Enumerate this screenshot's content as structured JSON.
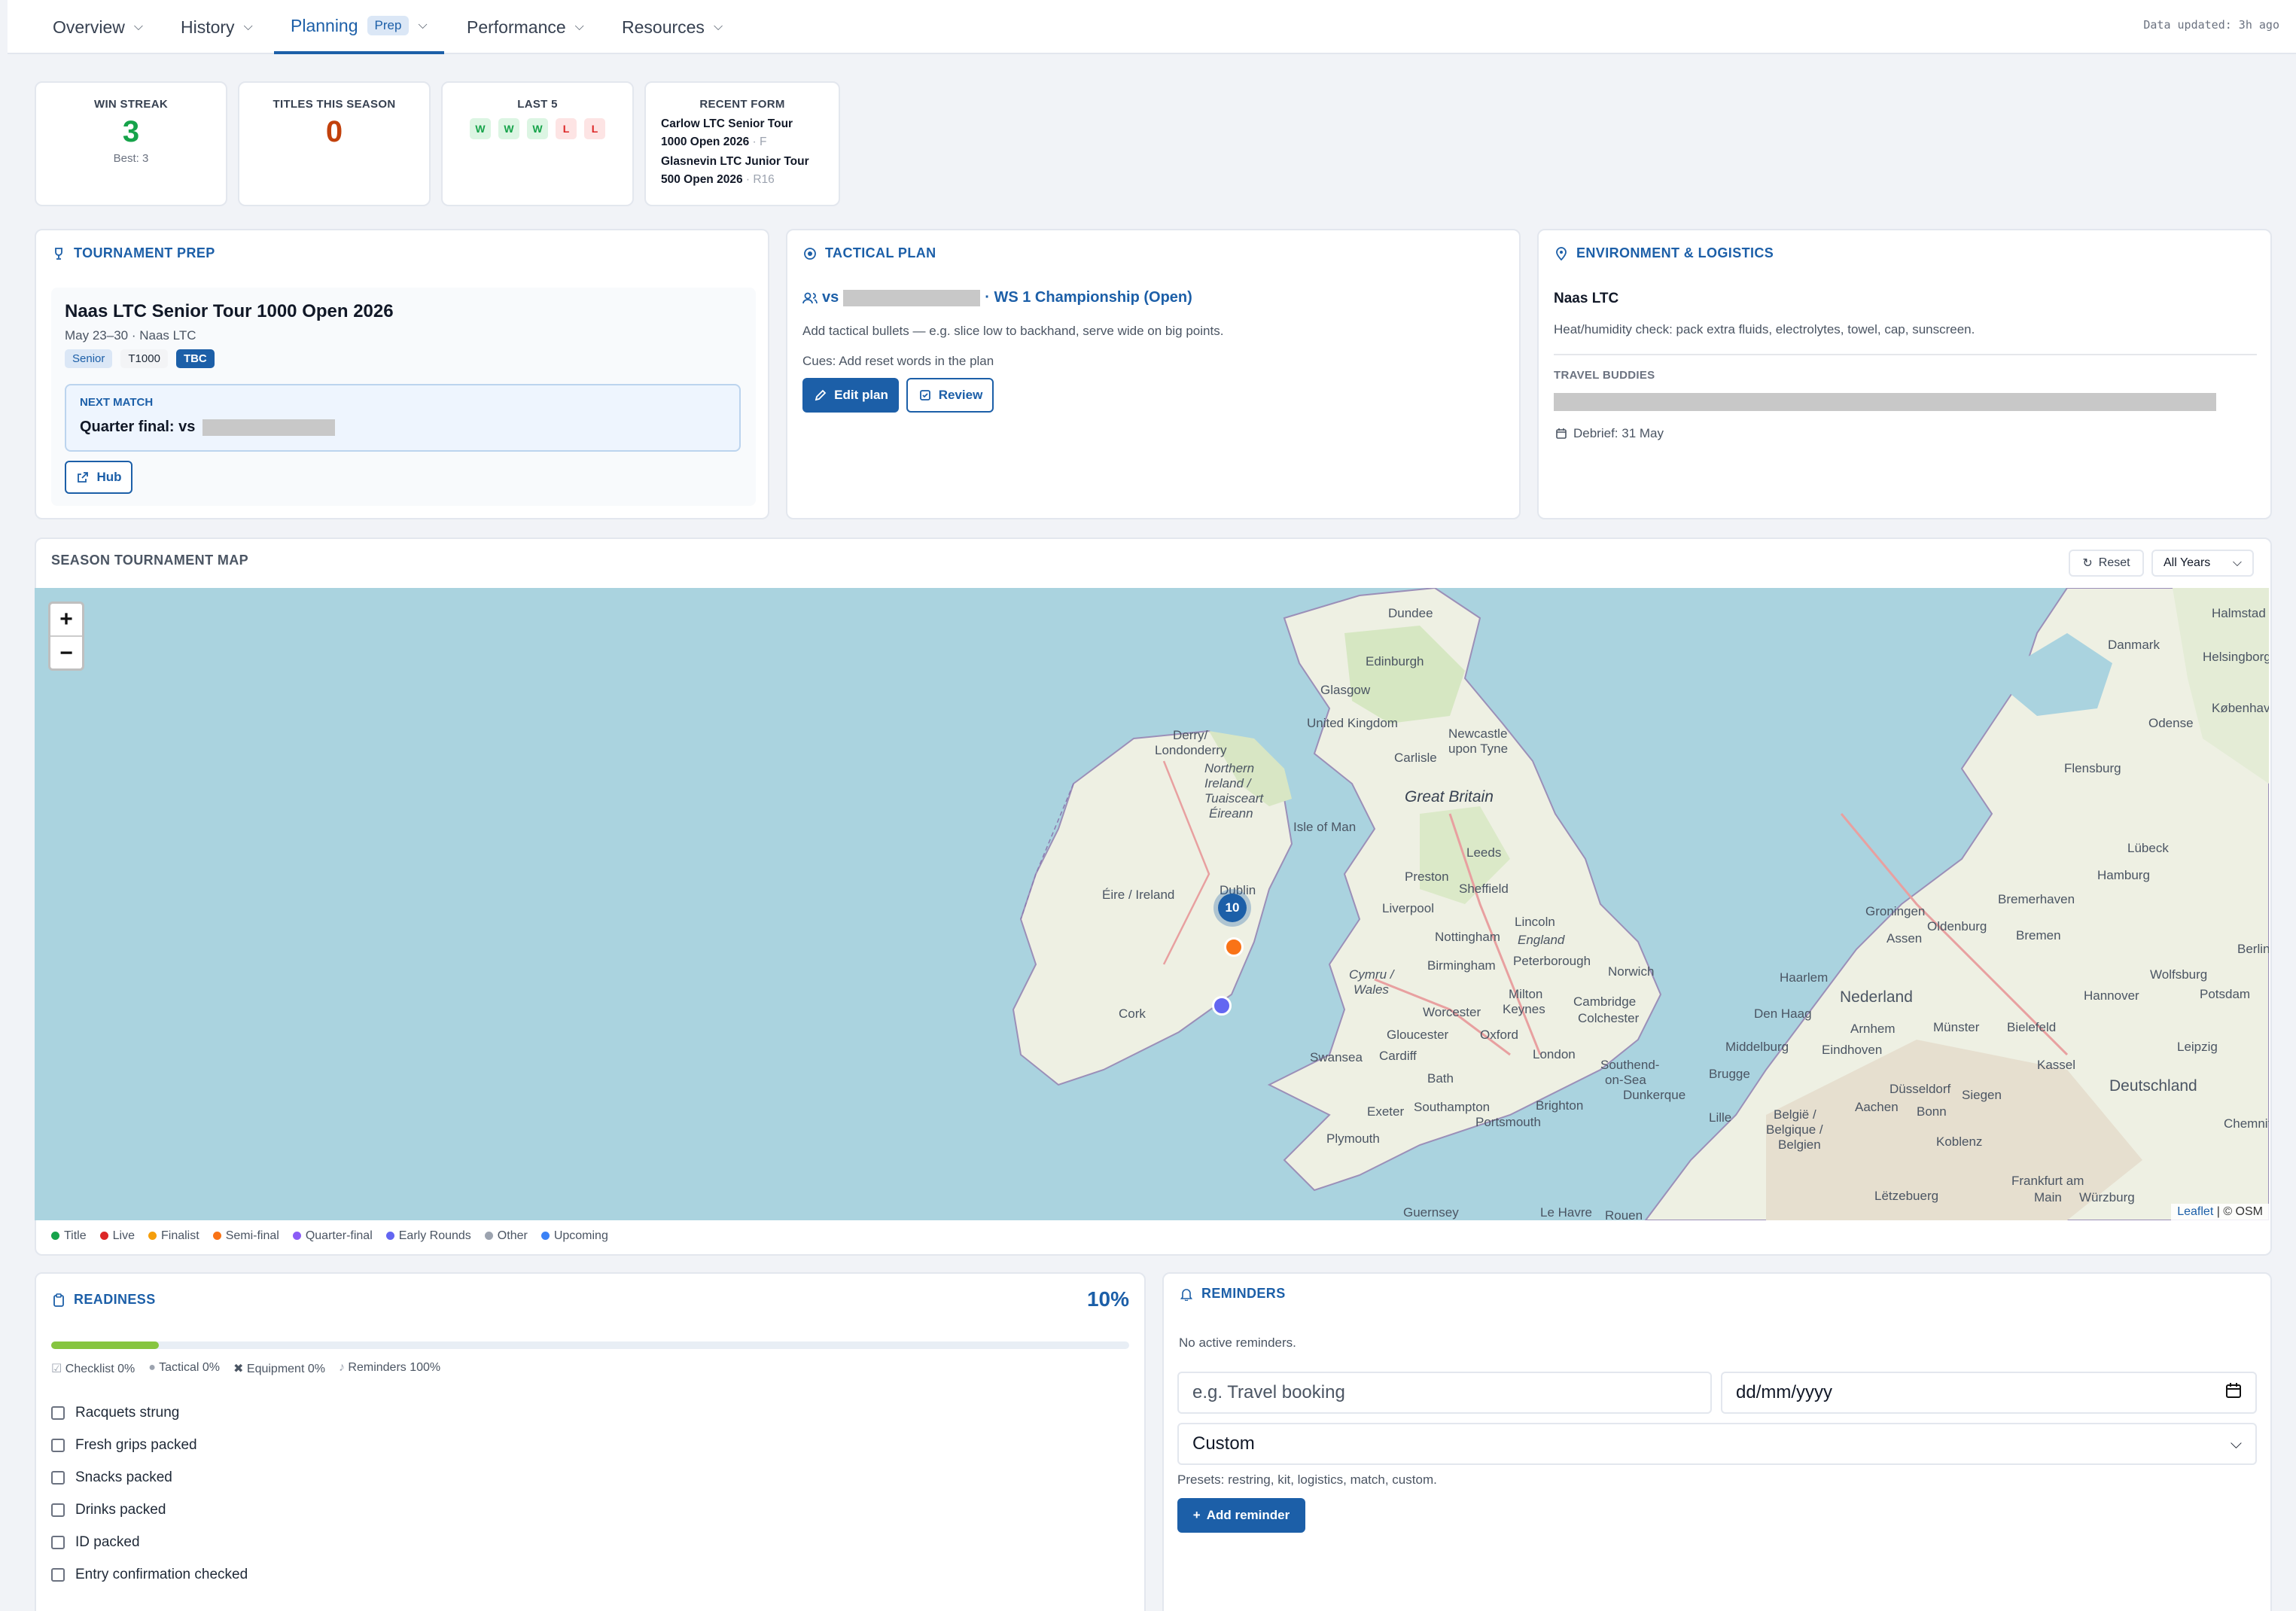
{
  "nav": {
    "items": [
      {
        "label": "Overview"
      },
      {
        "label": "History"
      },
      {
        "label": "Planning",
        "badge": "Prep"
      },
      {
        "label": "Performance"
      },
      {
        "label": "Resources"
      }
    ],
    "data_updated": "Data updated: 3h ago"
  },
  "stats": {
    "win_streak": {
      "title": "WIN STREAK",
      "value": "3",
      "sub": "Best: 3"
    },
    "titles": {
      "title": "TITLES THIS SEASON",
      "value": "0"
    },
    "last5": {
      "title": "LAST 5",
      "results": [
        "W",
        "W",
        "W",
        "L",
        "L"
      ]
    },
    "recent_form": {
      "title": "RECENT FORM",
      "items": [
        {
          "line1": "Carlow LTC Senior Tour",
          "line2": "1000 Open 2026",
          "round": "F"
        },
        {
          "line1": "Glasnevin LTC Junior Tour",
          "line2": "500 Open 2026",
          "round": "R16"
        }
      ]
    }
  },
  "prep": {
    "title": "TOURNAMENT PREP",
    "tournament": "Naas LTC Senior Tour 1000 Open 2026",
    "date_venue": "May 23–30 · Naas LTC",
    "tags": [
      "Senior",
      "T1000",
      "TBC"
    ],
    "next_match_label": "NEXT MATCH",
    "next_match": "Quarter final: vs",
    "hub_label": "Hub"
  },
  "tactical": {
    "title": "TACTICAL PLAN",
    "vs_prefix": "vs",
    "event": "· WS 1 Championship (Open)",
    "hint": "Add tactical bullets — e.g. slice low to backhand, serve wide on big points.",
    "cues": "Cues: Add reset words in the plan",
    "edit_label": "Edit plan",
    "review_label": "Review"
  },
  "environment": {
    "title": "ENVIRONMENT & LOGISTICS",
    "venue": "Naas LTC",
    "note": "Heat/humidity check: pack extra fluids, electrolytes, towel, cap, sunscreen.",
    "buddies_label": "TRAVEL BUDDIES",
    "debrief": "Debrief: 31 May"
  },
  "map": {
    "title": "SEASON TOURNAMENT MAP",
    "reset_label": "Reset",
    "year_select": "All Years",
    "cluster_count": "10",
    "attribution_link": "Leaflet",
    "attribution_rest": "| © OSM",
    "labels": {
      "dundee": "Dundee",
      "edinburgh": "Edinburgh",
      "glasgow": "Glasgow",
      "uk": "United Kingdom",
      "newcastle1": "Newcastle",
      "newcastle2": "upon Tyne",
      "carlisle": "Carlisle",
      "derry1": "Derry/",
      "derry2": "Londonderry",
      "ni1": "Northern",
      "ni2": "Ireland /",
      "ni3": "Tuaisceart",
      "ni4": "Éireann",
      "gb": "Great Britain",
      "iom": "Isle of Man",
      "leeds": "Leeds",
      "preston": "Preston",
      "sheffield": "Sheffield",
      "liverpool": "Liverpool",
      "ireland": "Éire / Ireland",
      "dublin": "Dublin",
      "nottingham": "Nottingham",
      "england": "England",
      "lincoln": "Lincoln",
      "birmingham": "Birmingham",
      "peterborough": "Peterborough",
      "norwich": "Norwich",
      "wales1": "Cymru /",
      "wales2": "Wales",
      "cork": "Cork",
      "worcester": "Worcester",
      "miltonk1": "Milton",
      "miltonk2": "Keynes",
      "cambridge": "Cambridge",
      "colchester": "Colchester",
      "gloucester": "Gloucester",
      "oxford": "Oxford",
      "swansea": "Swansea",
      "cardiff": "Cardiff",
      "london": "London",
      "southend1": "Southend-",
      "southend2": "on-Sea",
      "bath": "Bath",
      "southampton": "Southampton",
      "brighton": "Brighton",
      "portsmouth": "Portsmouth",
      "exeter": "Exeter",
      "plymouth": "Plymouth",
      "dunkerque": "Dunkerque",
      "guernsey": "Guernsey",
      "lehavre": "Le Havre",
      "rouen": "Rouen",
      "danmark": "Danmark",
      "kobenhavn": "København",
      "helsingborg": "Helsingborg",
      "halmstad": "Halmstad",
      "odense": "Odense",
      "flensburg": "Flensburg",
      "lubeck": "Lübeck",
      "hamburg": "Hamburg",
      "groningen": "Groningen",
      "bremerhaven": "Bremerhaven",
      "oldenburg": "Oldenburg",
      "bremen": "Bremen",
      "assen": "Assen",
      "berlin": "Berlin",
      "haarlem": "Haarlem",
      "nederland": "Nederland",
      "hannover": "Hannover",
      "wolfsburg": "Wolfsburg",
      "denhaag": "Den Haag",
      "arnhem": "Arnhem",
      "munster": "Münster",
      "bielefeld": "Bielefeld",
      "leipzig": "Leipzig",
      "middelburg": "Middelburg",
      "eindhoven": "Eindhoven",
      "kassel": "Kassel",
      "deutschland": "Deutschland",
      "brugge": "Brugge",
      "dusseldorf": "Düsseldorf",
      "lille": "Lille",
      "belgie1": "België /",
      "belgie2": "Belgique /",
      "belgie3": "Belgien",
      "bonn": "Bonn",
      "aachen": "Aachen",
      "siegen": "Siegen",
      "koblenz": "Koblenz",
      "frankfurt1": "Frankfurt am",
      "frankfurt2": "Main",
      "letzebuerg": "Lëtzebuerg",
      "wurzburg": "Würzburg",
      "chemnitz": "Chemnitz",
      "potsdam": "Potsdam"
    }
  },
  "legend": [
    {
      "label": "Title",
      "color": "#16a34a"
    },
    {
      "label": "Live",
      "color": "#dc2626"
    },
    {
      "label": "Finalist",
      "color": "#f59e0b"
    },
    {
      "label": "Semi-final",
      "color": "#f97316"
    },
    {
      "label": "Quarter-final",
      "color": "#8b5cf6"
    },
    {
      "label": "Early Rounds",
      "color": "#6366f1"
    },
    {
      "label": "Other",
      "color": "#9ca3af"
    },
    {
      "label": "Upcoming",
      "color": "#3b82f6"
    }
  ],
  "readiness": {
    "title": "READINESS",
    "percent": "10%",
    "progress": 0.1,
    "breakdown": {
      "checklist": "Checklist 0%",
      "tactical": "Tactical 0%",
      "equipment": "Equipment 0%",
      "reminders": "Reminders 100%"
    },
    "items": [
      "Racquets strung",
      "Fresh grips packed",
      "Snacks packed",
      "Drinks packed",
      "ID packed",
      "Entry confirmation checked"
    ]
  },
  "reminders": {
    "title": "REMINDERS",
    "empty": "No active reminders.",
    "input_placeholder": "e.g. Travel booking",
    "date_placeholder": "dd/mm/yyyy",
    "type_value": "Custom",
    "presets": "Presets: restring, kit, logistics, match, custom.",
    "add_label": "Add reminder"
  },
  "colors": {
    "accent": "#1c5fa8",
    "win": "#16a34a",
    "loss": "#dc2626",
    "titles": "#c2410c"
  }
}
